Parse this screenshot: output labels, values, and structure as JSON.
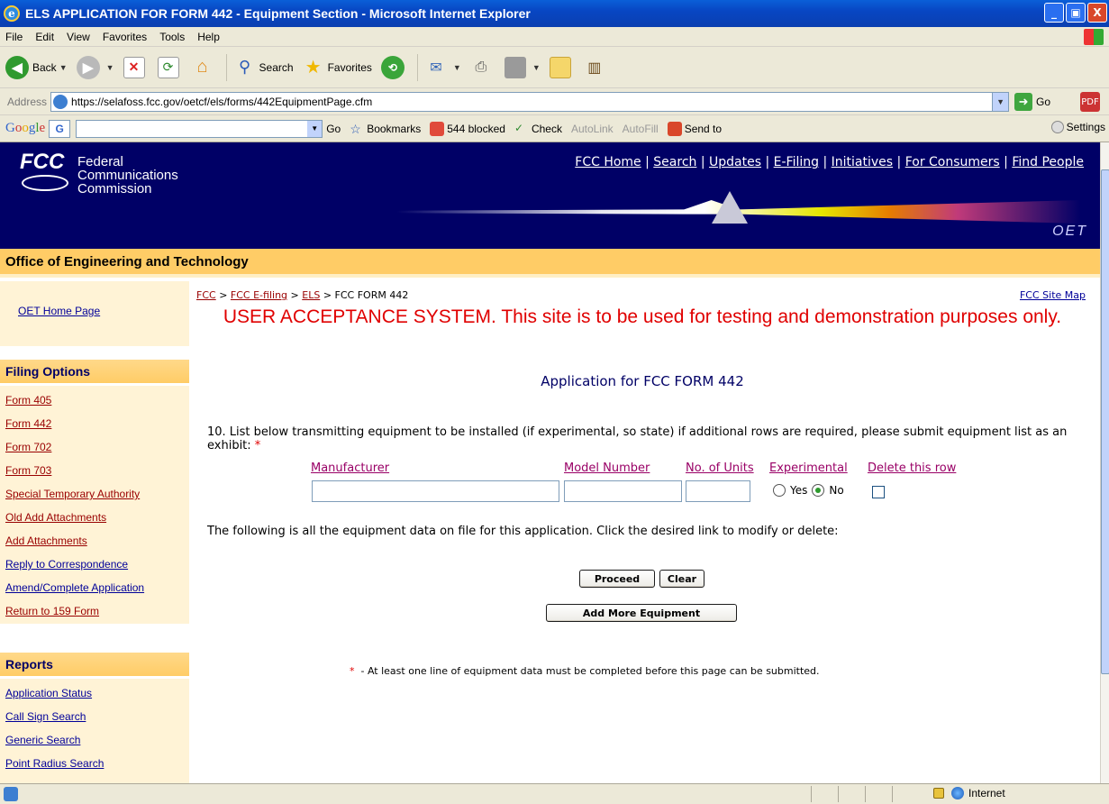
{
  "window": {
    "title": "ELS APPLICATION FOR FORM 442 - Equipment Section - Microsoft Internet Explorer",
    "minimize": "_",
    "maximize": "▣",
    "close": "X"
  },
  "menu": [
    "File",
    "Edit",
    "View",
    "Favorites",
    "Tools",
    "Help"
  ],
  "toolbar": {
    "back": "Back",
    "search": "Search",
    "favorites": "Favorites"
  },
  "address": {
    "label": "Address",
    "url": "https://selafoss.fcc.gov/oetcf/els/forms/442EquipmentPage.cfm",
    "go": "Go"
  },
  "googlebar": {
    "logo": "Google",
    "g_button": "G",
    "go": "Go",
    "bookmarks": "Bookmarks",
    "blocked": "544 blocked",
    "check": "Check",
    "autolink": "AutoLink",
    "autofill": "AutoFill",
    "sendto": "Send to",
    "settings": "Settings"
  },
  "fcc": {
    "logo_mark": "FCC",
    "name_line1": "Federal",
    "name_line2": "Communications",
    "name_line3": "Commission",
    "links": [
      "FCC Home",
      "Search",
      "Updates",
      "E-Filing",
      "Initiatives",
      "For Consumers",
      "Find People"
    ],
    "oet_mark": "OET",
    "office_bar": "Office of Engineering and Technology"
  },
  "leftnav": {
    "home": "OET Home Page",
    "filing_header": "Filing Options",
    "filing_items": [
      "Form 405",
      "Form 442",
      "Form 702",
      "Form 703",
      "Special Temporary Authority",
      "Old Add Attachments",
      "Add Attachments",
      "Reply to Correspondence",
      "Amend/Complete Application",
      "Return to 159 Form"
    ],
    "reports_header": "Reports",
    "report_items": [
      "Application Status",
      "Call Sign Search",
      "Generic Search",
      "Point Radius Search"
    ]
  },
  "breadcrumb": {
    "fcc": "FCC",
    "efiling": "FCC E-filing",
    "els": "ELS",
    "current": "FCC FORM 442",
    "sep": ">",
    "sitemap": "FCC Site Map"
  },
  "main": {
    "uat_banner": "USER ACCEPTANCE SYSTEM. This site is to be used for testing and demonstration purposes only.",
    "app_title": "Application for FCC FORM 442",
    "q10_text": "10. List below transmitting equipment to be installed (if experimental, so state) if additional rows are required, please submit equipment list as an exhibit:",
    "required_mark": "*",
    "columns": {
      "manufacturer": "Manufacturer",
      "model": "Model Number",
      "units": "No. of Units",
      "experimental": "Experimental",
      "delete": "Delete this row"
    },
    "row": {
      "manufacturer": "",
      "model": "",
      "units": "",
      "yes_label": "Yes",
      "no_label": "No",
      "experimental_selected": "No"
    },
    "equip_note": "The following is all the equipment data on file for this application. Click the desired link to modify or delete:",
    "proceed": "Proceed",
    "clear": "Clear",
    "add_more": "Add More Equipment",
    "footnote": "- At least one line of equipment data must be completed before this page can be submitted."
  },
  "status": {
    "zone": "Internet"
  }
}
